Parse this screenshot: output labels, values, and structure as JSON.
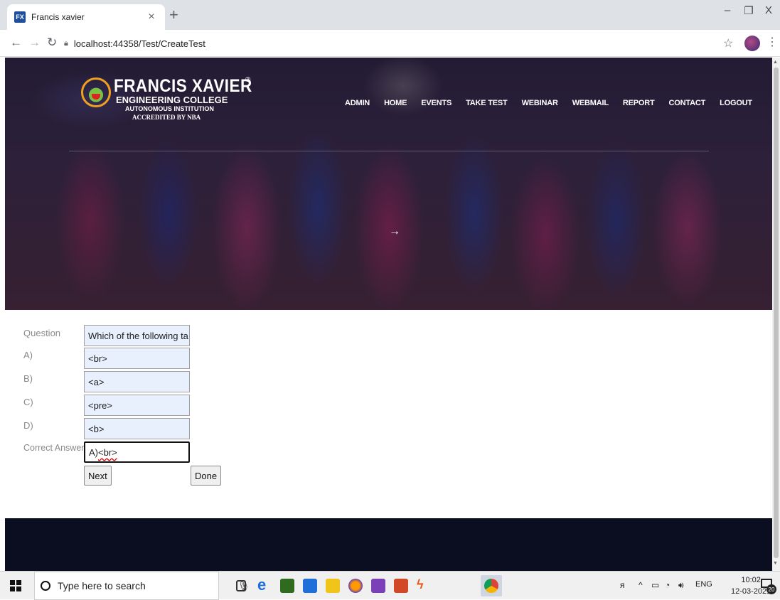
{
  "browser": {
    "tab_title": "Francis xavier",
    "favicon_text": "FX",
    "tab_close": "×",
    "new_tab": "+",
    "url": "localhost:44358/Test/CreateTest",
    "window_controls": {
      "minimize": "–",
      "restore": "❐",
      "close": "X"
    }
  },
  "site": {
    "logo": {
      "name": "FRANCIS XAVIER",
      "subtitle": "ENGINEERING COLLEGE",
      "tagline": "AUTONOMOUS INSTITUTION",
      "accreditation": "ACCREDITED BY NBA",
      "reg_mark": "®"
    },
    "nav": [
      "ADMIN",
      "HOME",
      "EVENTS",
      "TAKE TEST",
      "WEBINAR",
      "WEBMAIL",
      "REPORT",
      "CONTACT",
      "LOGOUT"
    ],
    "slider_arrow": "→"
  },
  "form": {
    "question_label": "Question",
    "question_value": "Which of the following ta",
    "a_label": "A)",
    "a_value": "<br>",
    "b_label": "B)",
    "b_value": "<a>",
    "c_label": "C)",
    "c_value": "<pre>",
    "d_label": "D)",
    "d_value": "<b>",
    "correct_label": "Correct Answer",
    "correct_prefix": "A)",
    "correct_value": "<br>",
    "next_button": "Next",
    "done_button": "Done"
  },
  "taskbar": {
    "search_placeholder": "Type here to search",
    "language": "ENG",
    "time": "10:02",
    "date": "12-03-2021",
    "notification_count": "20"
  }
}
